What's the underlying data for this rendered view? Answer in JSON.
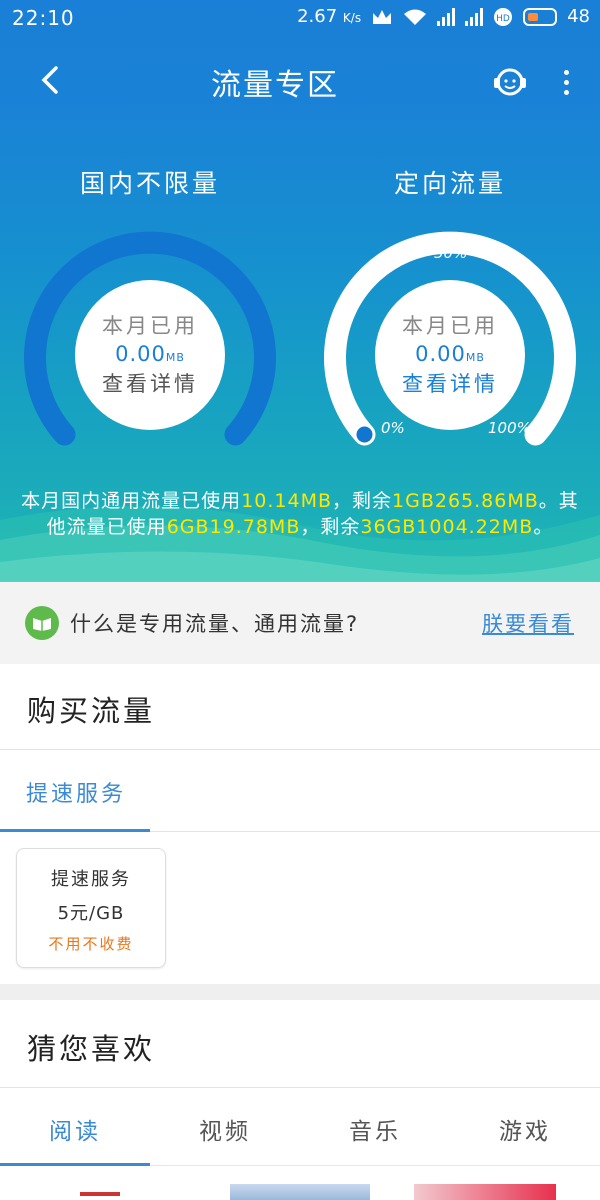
{
  "status_bar": {
    "time": "22:10",
    "speed": "2.67",
    "speed_unit": "K/s",
    "battery": "48"
  },
  "nav": {
    "title": "流量专区"
  },
  "gauges": {
    "domestic": {
      "title": "国内不限量",
      "label": "本月已用",
      "value": "0.00",
      "unit": "MB",
      "link": "查看详情"
    },
    "directional": {
      "title": "定向流量",
      "label": "本月已用",
      "value": "0.00",
      "unit": "MB",
      "link": "查看详情",
      "tick_min": "0%",
      "tick_mid": "50%",
      "tick_max": "100%",
      "used_fraction": 0.0
    }
  },
  "summary": {
    "part1": "本月国内通用流量已使用",
    "used_general": "10.14MB",
    "part2": "，剩余",
    "remain_general": "1GB265.86MB",
    "part3": "。其他流量已使用",
    "used_other": "6GB19.78MB",
    "part4": "，剩余",
    "remain_other": "36GB1004.22MB",
    "part5": "。"
  },
  "info_bar": {
    "question": "什么是专用流量、通用流量?",
    "link": "朕要看看"
  },
  "buy_section": {
    "title": "购买流量",
    "tab": "提速服务",
    "card": {
      "name": "提速服务",
      "price": "5元/GB",
      "note": "不用不收费"
    }
  },
  "recommend": {
    "title": "猜您喜欢",
    "tabs": [
      "阅读",
      "视频",
      "音乐",
      "游戏"
    ],
    "active_tab": 0
  },
  "colors": {
    "accent": "#3a8ad6",
    "highlight": "#ffe800",
    "note": "#e8771c"
  }
}
